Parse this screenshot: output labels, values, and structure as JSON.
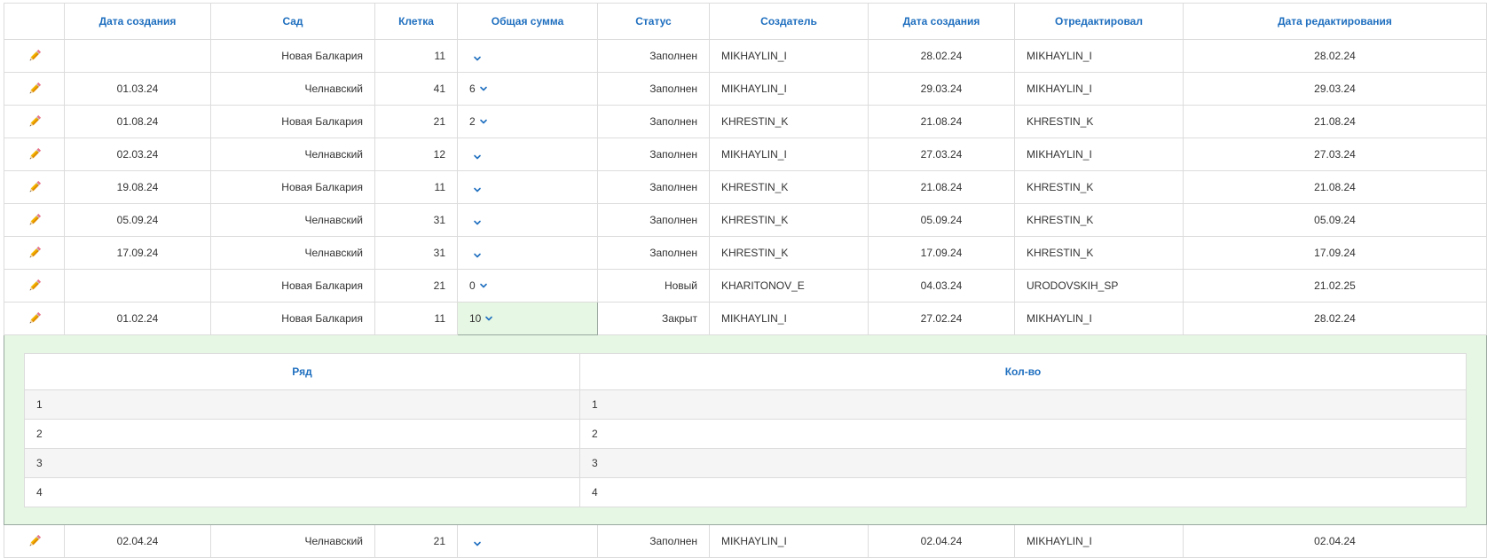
{
  "columns": [
    "",
    "Дата создания",
    "Сад",
    "Клетка",
    "Общая сумма",
    "Статус",
    "Создатель",
    "Дата создания",
    "Отредактировал",
    "Дата редактирования"
  ],
  "rows": [
    {
      "created": "",
      "garden": "Новая Балкария",
      "cell": "11",
      "sum": "",
      "status": "Заполнен",
      "creator": "MIKHAYLIN_I",
      "created2": "28.02.24",
      "editor": "MIKHAYLIN_I",
      "edited": "28.02.24"
    },
    {
      "created": "01.03.24",
      "garden": "Челнавский",
      "cell": "41",
      "sum": "6",
      "status": "Заполнен",
      "creator": "MIKHAYLIN_I",
      "created2": "29.03.24",
      "editor": "MIKHAYLIN_I",
      "edited": "29.03.24"
    },
    {
      "created": "01.08.24",
      "garden": "Новая Балкария",
      "cell": "21",
      "sum": "2",
      "status": "Заполнен",
      "creator": "KHRESTIN_K",
      "created2": "21.08.24",
      "editor": "KHRESTIN_K",
      "edited": "21.08.24"
    },
    {
      "created": "02.03.24",
      "garden": "Челнавский",
      "cell": "12",
      "sum": "",
      "status": "Заполнен",
      "creator": "MIKHAYLIN_I",
      "created2": "27.03.24",
      "editor": "MIKHAYLIN_I",
      "edited": "27.03.24"
    },
    {
      "created": "19.08.24",
      "garden": "Новая Балкария",
      "cell": "11",
      "sum": "",
      "status": "Заполнен",
      "creator": "KHRESTIN_K",
      "created2": "21.08.24",
      "editor": "KHRESTIN_K",
      "edited": "21.08.24"
    },
    {
      "created": "05.09.24",
      "garden": "Челнавский",
      "cell": "31",
      "sum": "",
      "status": "Заполнен",
      "creator": "KHRESTIN_K",
      "created2": "05.09.24",
      "editor": "KHRESTIN_K",
      "edited": "05.09.24"
    },
    {
      "created": "17.09.24",
      "garden": "Челнавский",
      "cell": "31",
      "sum": "",
      "status": "Заполнен",
      "creator": "KHRESTIN_K",
      "created2": "17.09.24",
      "editor": "KHRESTIN_K",
      "edited": "17.09.24"
    },
    {
      "created": "",
      "garden": "Новая Балкария",
      "cell": "21",
      "sum": "0",
      "status": "Новый",
      "creator": "KHARITONOV_E",
      "created2": "04.03.24",
      "editor": "URODOVSKIH_SP",
      "edited": "21.02.25"
    },
    {
      "created": "01.02.24",
      "garden": "Новая Балкария",
      "cell": "11",
      "sum": "10",
      "status": "Закрыт",
      "creator": "MIKHAYLIN_I",
      "created2": "27.02.24",
      "editor": "MIKHAYLIN_I",
      "edited": "28.02.24"
    },
    {
      "created": "02.04.24",
      "garden": "Челнавский",
      "cell": "21",
      "sum": "",
      "status": "Заполнен",
      "creator": "MIKHAYLIN_I",
      "created2": "02.04.24",
      "editor": "MIKHAYLIN_I",
      "edited": "02.04.24"
    }
  ],
  "detail": {
    "columns": [
      "Ряд",
      "Кол-во"
    ],
    "rows": [
      {
        "row": "1",
        "qty": "1"
      },
      {
        "row": "2",
        "qty": "2"
      },
      {
        "row": "3",
        "qty": "3"
      },
      {
        "row": "4",
        "qty": "4"
      }
    ]
  },
  "icons": {
    "edit": "pencil-icon",
    "expand": "chevron-down-icon"
  },
  "colors": {
    "header_text": "#1f6fbf",
    "expanded_bg": "#e6f7e3",
    "chevron": "#1f6fbf"
  }
}
